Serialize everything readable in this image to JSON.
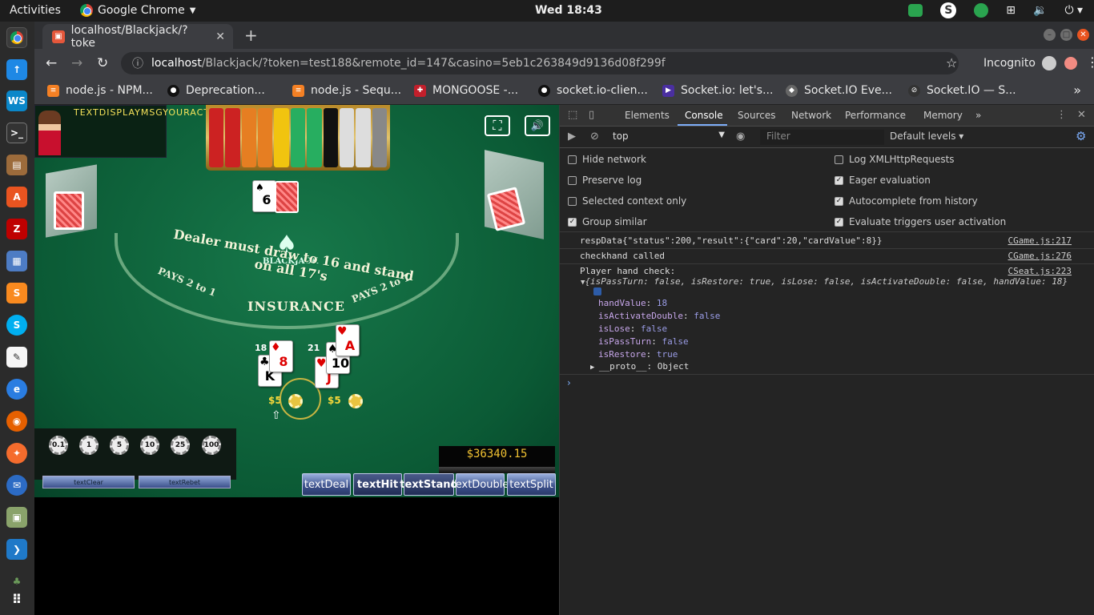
{
  "topbar": {
    "activities": "Activities",
    "app_name": "Google Chrome",
    "app_menu_arrow": "▼",
    "clock": "Wed 18:43"
  },
  "browser": {
    "tab_title": "localhost/Blackjack/?toke",
    "tab_close": "✕",
    "new_tab": "+",
    "url_host": "localhost",
    "url_rest": "/Blackjack/?token=test188&remote_id=147&casino=5eb1c263849d9136d08f299f",
    "incognito_label": "Incognito",
    "bookmarks": [
      {
        "label": "node.js - NPM...",
        "color": "#f48024"
      },
      {
        "label": "Deprecation...",
        "color": "#333333"
      },
      {
        "label": "node.js - Sequ...",
        "color": "#f48024"
      },
      {
        "label": "MONGOOSE -...",
        "color": "#c21f2b"
      },
      {
        "label": "socket.io-clien...",
        "color": "#333333"
      },
      {
        "label": "Socket.io: let's...",
        "color": "#4a2fa0"
      },
      {
        "label": "Socket.IO Eve...",
        "color": "#666666"
      },
      {
        "label": "Socket.IO — S...",
        "color": "#333333"
      }
    ],
    "bookmarks_more": "»"
  },
  "game": {
    "dealer_message": "TEXTDISPLAYMSGYOURACTION",
    "table_text": "Dealer must draw to 16 and stand on all 17's",
    "pays_left": "PAYS 2 to 1",
    "pays_right": "PAYS 2 to 1",
    "insurance": "INSURANCE",
    "logo_text": "BLACKJACK",
    "dealer_card": {
      "rank": "6",
      "suit": "♠"
    },
    "hand1": {
      "value": "18",
      "cards": [
        {
          "rank": "K",
          "suit": "♣"
        },
        {
          "rank": "8",
          "suit": "♦"
        }
      ],
      "bet": "$5",
      "chip": "5"
    },
    "hand2": {
      "value": "21",
      "cards": [
        {
          "rank": "J",
          "suit": "♥"
        },
        {
          "rank": "10",
          "suit": "♠"
        },
        {
          "rank": "A",
          "suit": "♥"
        }
      ],
      "bet": "$5",
      "chip": "5"
    },
    "denominations": [
      "0.1",
      "1",
      "5",
      "10",
      "25",
      "100"
    ],
    "balance": "$36340.15",
    "small_buttons": [
      "textClear",
      "textRebet"
    ],
    "action_buttons": [
      "textDeal",
      "textHit",
      "textStand",
      "textDouble",
      "textSplit"
    ],
    "active_button": "textHit",
    "fullscreen_icon": "⛶",
    "sound_icon": "🔊"
  },
  "devtools": {
    "tabs": [
      "Elements",
      "Console",
      "Sources",
      "Network",
      "Performance",
      "Memory"
    ],
    "active_tab": "Console",
    "more_tabs": "»",
    "context": "top",
    "filter_placeholder": "Filter",
    "levels": "Default levels ▾",
    "options_left": [
      {
        "label": "Hide network",
        "checked": false
      },
      {
        "label": "Preserve log",
        "checked": false
      },
      {
        "label": "Selected context only",
        "checked": false
      },
      {
        "label": "Group similar",
        "checked": true
      }
    ],
    "options_right": [
      {
        "label": "Log XMLHttpRequests",
        "checked": false
      },
      {
        "label": "Eager evaluation",
        "checked": true
      },
      {
        "label": "Autocomplete from history",
        "checked": true
      },
      {
        "label": "Evaluate triggers user activation",
        "checked": true
      }
    ],
    "logs": [
      {
        "text": "respData{\"status\":200,\"result\":{\"card\":20,\"cardValue\":8}}",
        "source": "CGame.js:217"
      },
      {
        "text": "checkhand called",
        "source": "CGame.js:276"
      },
      {
        "text": "Player hand check:",
        "source": "CSeat.js:223"
      }
    ],
    "object_summary": "{isPassTurn: false, isRestore: true, isLose: false, isActivateDouble: false, handValue: 18}",
    "properties": [
      {
        "key": "handValue",
        "value": "18"
      },
      {
        "key": "isActivateDouble",
        "value": "false"
      },
      {
        "key": "isLose",
        "value": "false"
      },
      {
        "key": "isPassTurn",
        "value": "false"
      },
      {
        "key": "isRestore",
        "value": "true"
      }
    ],
    "proto": "__proto__: Object",
    "prompt": "›"
  }
}
